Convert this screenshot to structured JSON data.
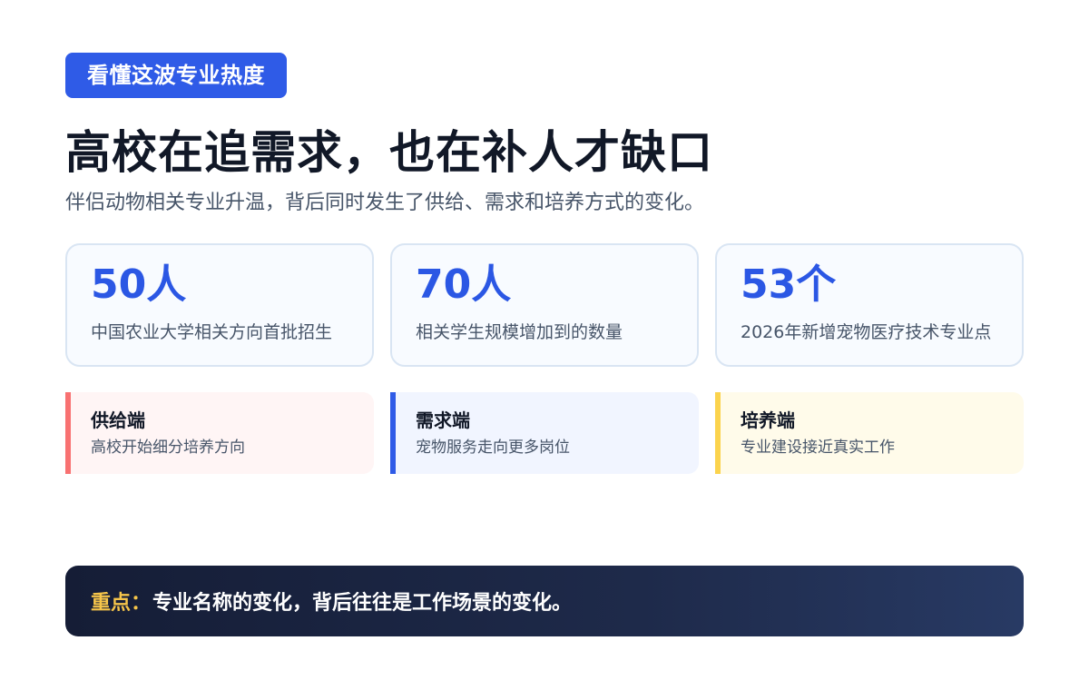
{
  "header": {
    "tag": "看懂这波专业热度",
    "title": "高校在追需求，也在补人才缺口",
    "subtitle": "伴侣动物相关专业升温，背后同时发生了供给、需求和培养方式的变化。"
  },
  "stats": [
    {
      "value": "50人",
      "label": "中国农业大学相关方向首批招生"
    },
    {
      "value": "70人",
      "label": "相关学生规模增加到的数量"
    },
    {
      "value": "53个",
      "label": "2026年新增宠物医疗技术专业点"
    }
  ],
  "sides": [
    {
      "title": "供给端",
      "desc": "高校开始细分培养方向",
      "color": "#f87171"
    },
    {
      "title": "需求端",
      "desc": "宠物服务走向更多岗位",
      "color": "#2f5be7"
    },
    {
      "title": "培养端",
      "desc": "专业建设接近真实工作",
      "color": "#fbd34d"
    }
  ],
  "note": {
    "key": "重点：",
    "text": "专业名称的变化，背后往往是工作场景的变化。"
  }
}
